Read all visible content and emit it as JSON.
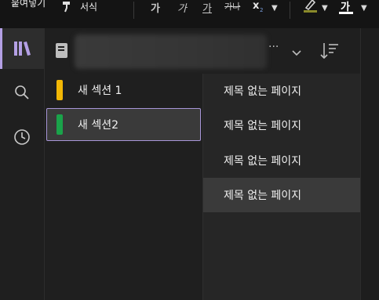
{
  "toolbar": {
    "paste_label": "붙여넣기",
    "format_painter_label": "서식",
    "format_bold": "가",
    "format_italic": "가",
    "format_underline": "가",
    "format_strike": "가나",
    "format_subscript": "x",
    "font_color_label": "가",
    "colors": {
      "highlight": "#8a8a2a",
      "font_color": "#ffffff"
    }
  },
  "rail": {
    "items": [
      "notebooks-icon",
      "search-icon",
      "recent-icon"
    ],
    "accent": "#b4a0e5"
  },
  "notebook": {
    "icon": "notebook-icon",
    "more": "···"
  },
  "sections": [
    {
      "label": "새 섹션 1",
      "color": "#f2b705",
      "selected": false
    },
    {
      "label": "새 섹션2",
      "color": "#1aa34a",
      "selected": true
    }
  ],
  "pages": [
    {
      "label": "제목 없는 페이지",
      "selected": false
    },
    {
      "label": "제목 없는 페이지",
      "selected": false
    },
    {
      "label": "제목 없는 페이지",
      "selected": false
    },
    {
      "label": "제목 없는 페이지",
      "selected": true
    }
  ]
}
